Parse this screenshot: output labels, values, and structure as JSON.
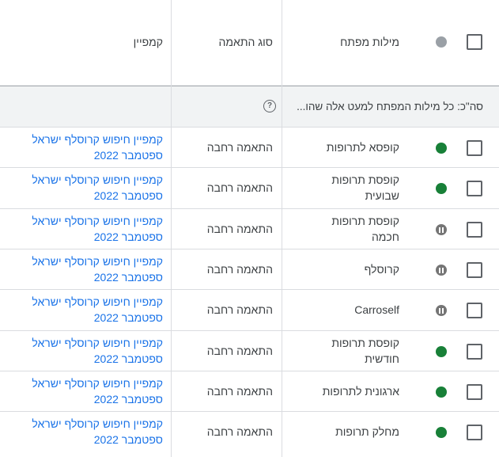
{
  "header": {
    "keyword_label": "מילות מפתח",
    "match_type_label": "סוג התאמה",
    "campaign_label": "קמפיין"
  },
  "total_row": {
    "label": "סה\"כ: כל מילות המפתח למעט אלה שהו...",
    "help_icon": "?"
  },
  "rows": [
    {
      "keyword": [
        "קופסא לתרופות"
      ],
      "status": "enabled",
      "match_type": "התאמה רחבה",
      "campaign": [
        "קמפיין חיפוש קרוסלף ישראל",
        "ספטמבר 2022"
      ]
    },
    {
      "keyword": [
        "קופסת תרופות",
        "שבועית"
      ],
      "status": "enabled",
      "match_type": "התאמה רחבה",
      "campaign": [
        "קמפיין חיפוש קרוסלף ישראל",
        "ספטמבר 2022"
      ]
    },
    {
      "keyword": [
        "קופסת תרופות",
        "חכמה"
      ],
      "status": "paused",
      "match_type": "התאמה רחבה",
      "campaign": [
        "קמפיין חיפוש קרוסלף ישראל",
        "ספטמבר 2022"
      ]
    },
    {
      "keyword": [
        "קרוסלף"
      ],
      "status": "paused",
      "match_type": "התאמה רחבה",
      "campaign": [
        "קמפיין חיפוש קרוסלף ישראל",
        "ספטמבר 2022"
      ]
    },
    {
      "keyword": [
        "Carroself"
      ],
      "status": "paused",
      "match_type": "התאמה רחבה",
      "campaign": [
        "קמפיין חיפוש קרוסלף ישראל",
        "ספטמבר 2022"
      ]
    },
    {
      "keyword": [
        "קופסת תרופות",
        "חודשית"
      ],
      "status": "enabled",
      "match_type": "התאמה רחבה",
      "campaign": [
        "קמפיין חיפוש קרוסלף ישראל",
        "ספטמבר 2022"
      ]
    },
    {
      "keyword": [
        "ארגונית לתרופות"
      ],
      "status": "enabled",
      "match_type": "התאמה רחבה",
      "campaign": [
        "קמפיין חיפוש קרוסלף ישראל",
        "ספטמבר 2022"
      ]
    },
    {
      "keyword": [
        "מחלק תרופות"
      ],
      "status": "enabled",
      "match_type": "התאמה רחבה",
      "campaign": [
        "קמפיין חיפוש קרוסלף ישראל",
        "ספטמבר 2022"
      ]
    }
  ],
  "colors": {
    "enabled": "#188038",
    "paused": "#757575",
    "header_status": "#9aa0a6",
    "link": "#1a73e8"
  }
}
